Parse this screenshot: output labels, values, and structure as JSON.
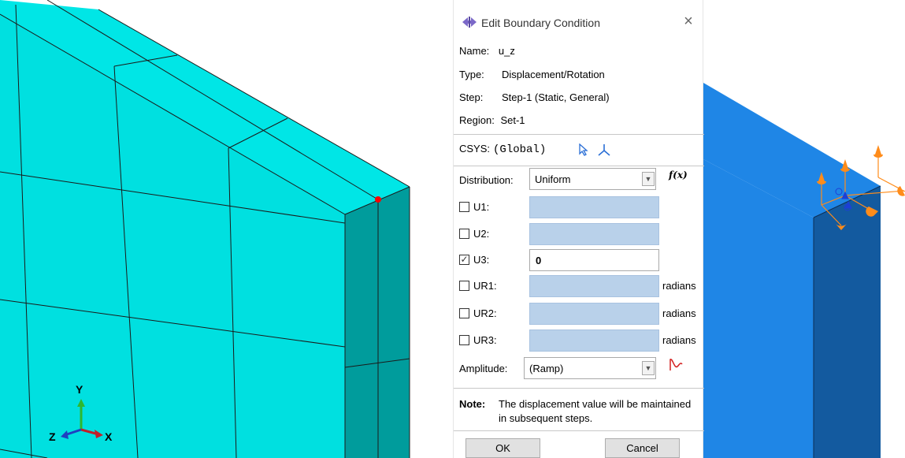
{
  "dialog": {
    "title": "Edit Boundary Condition",
    "close_glyph": "×",
    "info": [
      {
        "label": "Name:",
        "value": "u_z"
      },
      {
        "label": "Type:",
        "value": "Displacement/Rotation"
      },
      {
        "label": "Step:",
        "value": "Step-1 (Static, General)"
      },
      {
        "label": "Region:",
        "value": "Set-1"
      }
    ],
    "csys": {
      "label": "CSYS:",
      "value": "(Global)",
      "icons": [
        "select-arrow-icon",
        "csys-axis-icon"
      ]
    },
    "distribution": {
      "label": "Distribution:",
      "value": "Uniform",
      "fx_label": "f(x)"
    },
    "dofs": [
      {
        "label": "U1:",
        "checked": false,
        "value": "",
        "unit": ""
      },
      {
        "label": "U2:",
        "checked": false,
        "value": "",
        "unit": ""
      },
      {
        "label": "U3:",
        "checked": true,
        "value": "0",
        "unit": ""
      },
      {
        "label": "UR1:",
        "checked": false,
        "value": "",
        "unit": "radians"
      },
      {
        "label": "UR2:",
        "checked": false,
        "value": "",
        "unit": "radians"
      },
      {
        "label": "UR3:",
        "checked": false,
        "value": "",
        "unit": "radians"
      }
    ],
    "amplitude": {
      "label": "Amplitude:",
      "value": "(Ramp)"
    },
    "note": {
      "head": "Note:",
      "text": "The displacement value will be maintained in subsequent steps."
    },
    "buttons": {
      "ok": "OK",
      "cancel": "Cancel"
    }
  },
  "viewport": {
    "triad": {
      "x": "X",
      "y": "Y",
      "z": "Z"
    },
    "colors": {
      "mesh_face": "#00e0e0",
      "mesh_side": "#009a9a",
      "mesh_edge": "#1a1a1a",
      "selected_node": "#ff0000",
      "part_face": "#1f86e6",
      "part_side": "#135a9f",
      "bc_symbol": "#ff8c1a",
      "bc_symbol_blue": "#1c3fd6"
    }
  }
}
